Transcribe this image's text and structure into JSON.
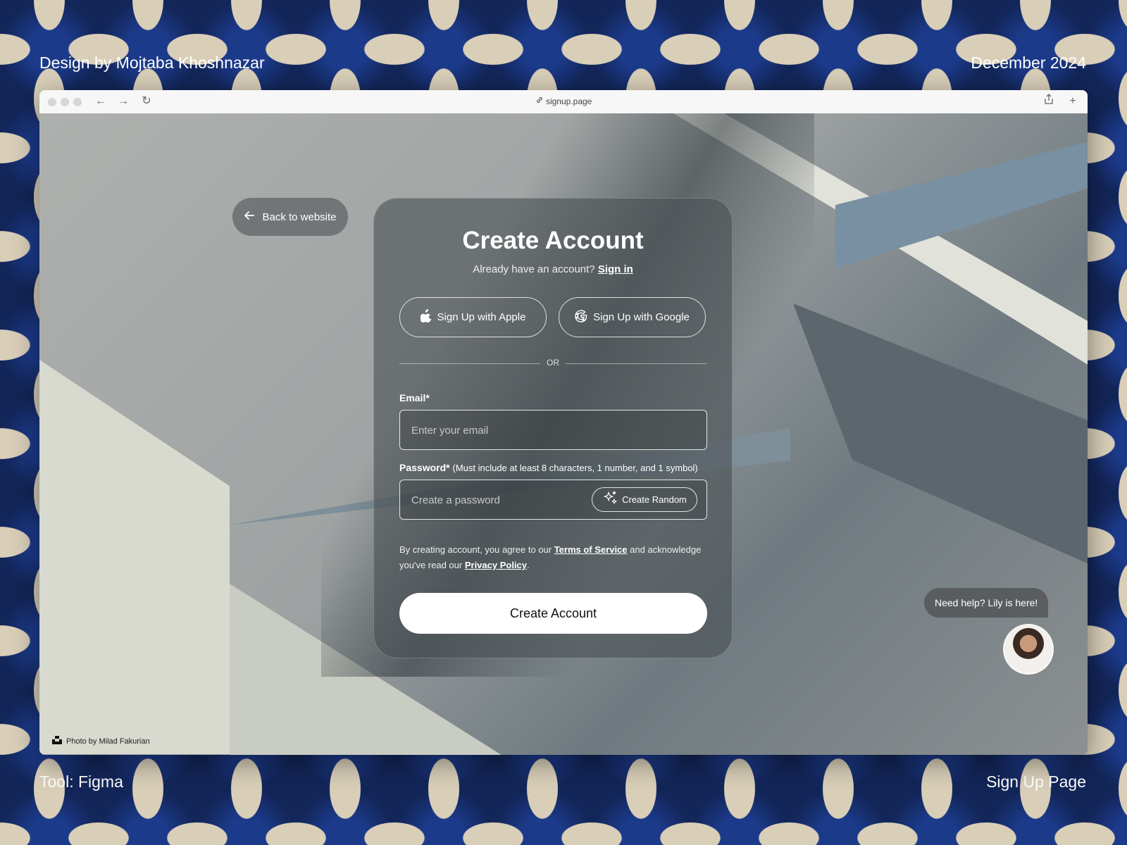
{
  "meta": {
    "designer": "Design by Mojtaba Khoshnazar",
    "date": "December 2024",
    "tool": "Tool: Figma",
    "page_name": "Sign Up Page"
  },
  "browser": {
    "url": "signup.page"
  },
  "page": {
    "back_label": "Back to website",
    "title": "Create Account",
    "subtitle": "Already have an account?",
    "signin_link": "Sign in",
    "apple_label": "Sign Up with Apple",
    "google_label": "Sign Up with Google",
    "or_label": "OR",
    "email": {
      "label": "Email*",
      "placeholder": "Enter your email",
      "value": ""
    },
    "password": {
      "label": "Password*",
      "hint": "(Must include at least 8 characters, 1 number, and 1 symbol)",
      "placeholder": "Create a password",
      "value": "",
      "random_label": "Create Random"
    },
    "terms": {
      "prefix": "By creating account, you agree to our",
      "tos_link": "Terms of Service",
      "middle": "and acknowledge you've read our",
      "privacy_link": "Privacy Policy",
      "suffix": "."
    },
    "submit_label": "Create Account",
    "help_text": "Need help? Lily is here!",
    "photo_credit": "Photo by Milad Fakurian"
  },
  "icons": {
    "back": "arrow-left-icon",
    "apple": "apple-icon",
    "google": "google-icon",
    "random": "sparkle-icon",
    "link": "link-icon",
    "share": "share-icon",
    "new_tab": "plus-icon",
    "credit": "unsplash-icon"
  }
}
